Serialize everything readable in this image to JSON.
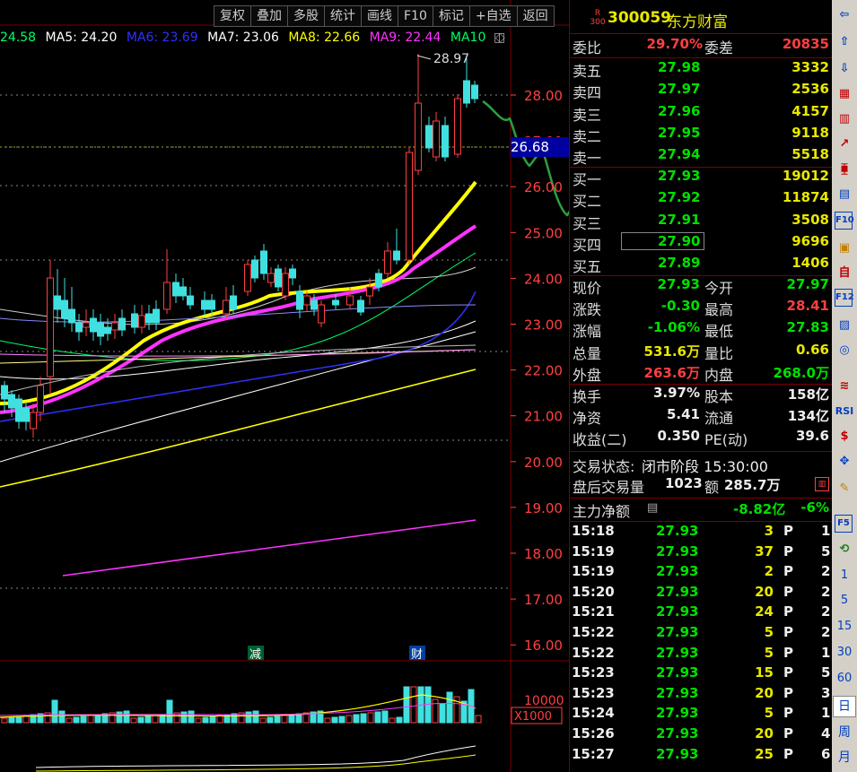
{
  "toolbar": {
    "buttons": [
      "复权",
      "叠加",
      "多股",
      "统计",
      "画线",
      "F10",
      "标记",
      "+自选",
      "返回"
    ]
  },
  "ma_legend": [
    {
      "text": "24.58",
      "color": "#00ff66"
    },
    {
      "text": "MA5: 24.20",
      "color": "#ffffff"
    },
    {
      "text": "MA6: 23.69",
      "color": "#3030ff"
    },
    {
      "text": "MA7: 23.06",
      "color": "#ffffff"
    },
    {
      "text": "MA8: 22.66",
      "color": "#ffff00"
    },
    {
      "text": "MA9: 22.44",
      "color": "#ff33ff"
    },
    {
      "text": "MA10",
      "color": "#00ff66"
    }
  ],
  "price_axis": [
    "28.00",
    "27.00",
    "26.00",
    "25.00",
    "24.00",
    "23.00",
    "22.00",
    "21.00",
    "20.00",
    "19.00",
    "18.00",
    "17.00",
    "16.00"
  ],
  "current_price_tag": "26.68",
  "high_label": "28.97",
  "chart_markers": [
    "减",
    "财"
  ],
  "volume_axis": {
    "value": "10000",
    "unit": "X1000"
  },
  "stock": {
    "flag_top": "R",
    "flag_bottom": "300",
    "code": "300059",
    "name": "东方财富"
  },
  "ratio": {
    "wb_label": "委比",
    "wb_value": "29.70%",
    "wc_label": "委差",
    "wc_value": "20835"
  },
  "asks": [
    {
      "label": "卖五",
      "price": "27.98",
      "vol": "3332"
    },
    {
      "label": "卖四",
      "price": "27.97",
      "vol": "2536"
    },
    {
      "label": "卖三",
      "price": "27.96",
      "vol": "4157"
    },
    {
      "label": "卖二",
      "price": "27.95",
      "vol": "9118"
    },
    {
      "label": "卖一",
      "price": "27.94",
      "vol": "5518"
    }
  ],
  "bids": [
    {
      "label": "买一",
      "price": "27.93",
      "vol": "19012"
    },
    {
      "label": "买二",
      "price": "27.92",
      "vol": "11874"
    },
    {
      "label": "买三",
      "price": "27.91",
      "vol": "3508"
    },
    {
      "label": "买四",
      "price": "27.90",
      "vol": "9696"
    },
    {
      "label": "买五",
      "price": "27.89",
      "vol": "1406"
    }
  ],
  "quote": [
    {
      "l1": "现价",
      "v1": "27.93",
      "l2": "今开",
      "v2": "27.97"
    },
    {
      "l1": "涨跌",
      "v1": "-0.30",
      "l2": "最高",
      "v2": "28.41"
    },
    {
      "l1": "涨幅",
      "v1": "-1.06%",
      "l2": "最低",
      "v2": "27.83"
    },
    {
      "l1": "总量",
      "v1": "531.6万",
      "l2": "量比",
      "v2": "0.66"
    },
    {
      "l1": "外盘",
      "v1": "263.6万",
      "l2": "内盘",
      "v2": "268.0万"
    }
  ],
  "fundamentals": [
    {
      "l1": "换手",
      "v1": "3.97%",
      "l2": "股本",
      "v2": "158亿"
    },
    {
      "l1": "净资",
      "v1": "5.41",
      "l2": "流通",
      "v2": "134亿"
    },
    {
      "l1": "收益(二)",
      "v1": "0.350",
      "l2": "PE(动)",
      "v2": "39.6"
    }
  ],
  "trade_status": {
    "label": "交易状态:",
    "value": "闭市阶段 15:30:00"
  },
  "after_hours": {
    "label": "盘后交易量",
    "vol": "1023",
    "amt_label": "额",
    "amt": "285.7万"
  },
  "main_flow": {
    "label": "主力净额",
    "value": "-8.82亿",
    "pct": "-6%"
  },
  "ticks": [
    {
      "time": "15:18",
      "price": "27.93",
      "vol": "3",
      "flag": "P",
      "n": "1"
    },
    {
      "time": "15:19",
      "price": "27.93",
      "vol": "37",
      "flag": "P",
      "n": "5"
    },
    {
      "time": "15:19",
      "price": "27.93",
      "vol": "2",
      "flag": "P",
      "n": "2"
    },
    {
      "time": "15:20",
      "price": "27.93",
      "vol": "20",
      "flag": "P",
      "n": "2"
    },
    {
      "time": "15:21",
      "price": "27.93",
      "vol": "24",
      "flag": "P",
      "n": "2"
    },
    {
      "time": "15:22",
      "price": "27.93",
      "vol": "5",
      "flag": "P",
      "n": "2"
    },
    {
      "time": "15:22",
      "price": "27.93",
      "vol": "5",
      "flag": "P",
      "n": "1"
    },
    {
      "time": "15:23",
      "price": "27.93",
      "vol": "15",
      "flag": "P",
      "n": "5"
    },
    {
      "time": "15:23",
      "price": "27.93",
      "vol": "20",
      "flag": "P",
      "n": "3"
    },
    {
      "time": "15:24",
      "price": "27.93",
      "vol": "5",
      "flag": "P",
      "n": "1"
    },
    {
      "time": "15:26",
      "price": "27.93",
      "vol": "20",
      "flag": "P",
      "n": "4"
    },
    {
      "time": "15:27",
      "price": "27.93",
      "vol": "25",
      "flag": "P",
      "n": "6"
    }
  ],
  "sidebar_numbers": [
    "1",
    "5",
    "15",
    "30",
    "60"
  ],
  "sidebar_text": [
    "日",
    "周",
    "月"
  ],
  "sidebar_icons": [
    "RSI"
  ],
  "colors": {
    "up": "#ff4040",
    "down": "#00e0e0",
    "frame": "#7a0000",
    "annotation": "#2e9e3e"
  }
}
